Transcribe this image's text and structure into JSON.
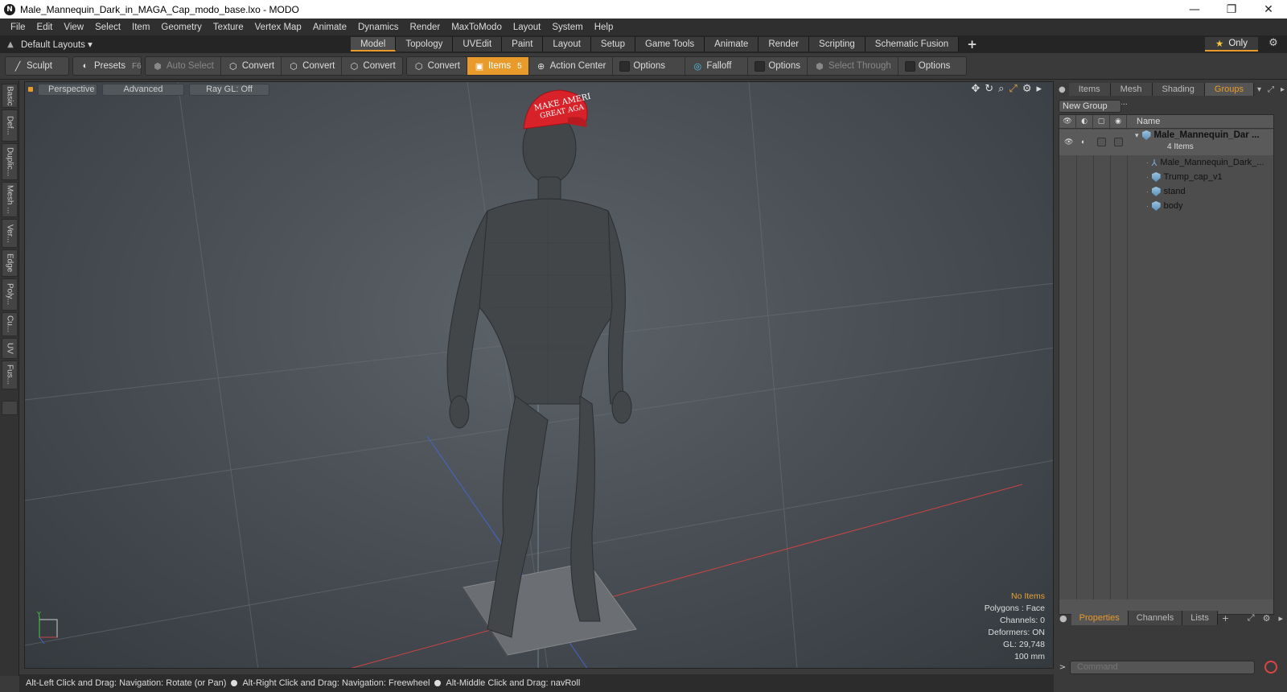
{
  "window": {
    "title": "Male_Mannequin_Dark_in_MAGA_Cap_modo_base.lxo - MODO",
    "app_icon": "N",
    "controls": [
      "—",
      "❐",
      "✕"
    ]
  },
  "menu": [
    "File",
    "Edit",
    "View",
    "Select",
    "Item",
    "Geometry",
    "Texture",
    "Vertex Map",
    "Animate",
    "Dynamics",
    "Render",
    "MaxToModo",
    "Layout",
    "System",
    "Help"
  ],
  "layoutbar": {
    "layouts_label": "Default Layouts ▾",
    "tabs": [
      "Model",
      "Topology",
      "UVEdit",
      "Paint",
      "Layout",
      "Setup",
      "Game Tools",
      "Animate",
      "Render",
      "Scripting",
      "Schematic Fusion"
    ],
    "active_tab": "Model",
    "plus": "+",
    "only_label": "Only",
    "star": "★"
  },
  "toolbar": {
    "sculpt": "Sculpt",
    "presets": "Presets",
    "presets_key": "F6",
    "auto_select": "Auto Select",
    "convert_1": "Convert",
    "convert_2": "Convert",
    "convert_3": "Convert",
    "convert_4": "Convert",
    "items": "Items",
    "items_key": "5",
    "action_center": "Action Center",
    "options_1": "Options",
    "falloff": "Falloff",
    "options_2": "Options",
    "select_through": "Select Through",
    "options_3": "Options"
  },
  "lefttabs": [
    "Basic",
    "Def...",
    "Duplic...",
    "Mesh ...",
    "Ver...",
    "Edge",
    "Poly...",
    "Cu...",
    "UV",
    "Fus..."
  ],
  "viewport": {
    "perspective": "Perspective",
    "advanced": "Advanced",
    "raygl": "Ray GL: Off",
    "cap_text_1": "MAKE AMERI",
    "cap_text_2": "GREAT AGA",
    "axis_y": "Y",
    "info": {
      "no_items": "No Items",
      "polygons": "Polygons : Face",
      "channels": "Channels: 0",
      "deformers": "Deformers: ON",
      "gl": "GL: 29,748",
      "scale": "100 mm"
    }
  },
  "status": {
    "hint_1": "Alt-Left Click and Drag: Navigation: Rotate (or Pan)",
    "hint_2": "Alt-Right Click and Drag: Navigation: Freewheel",
    "hint_3": "Alt-Middle Click and Drag: navRoll"
  },
  "rightpanel": {
    "tabs": [
      "Items",
      "Mesh ...",
      "Shading",
      "Groups"
    ],
    "active_tab": "Groups",
    "new_group": "New Group",
    "col_name": "Name",
    "group_name": "Male_Mannequin_Dar ...",
    "group_count": "4 Items",
    "children": [
      "Male_Mannequin_Dark_...",
      "Trump_cap_v1",
      "stand",
      "body"
    ],
    "bottom_tabs": [
      "Properties",
      "Channels",
      "Lists"
    ],
    "bottom_active": "Properties",
    "bottom_plus": "+",
    "command_placeholder": "Command",
    "command_arrow": ">"
  }
}
